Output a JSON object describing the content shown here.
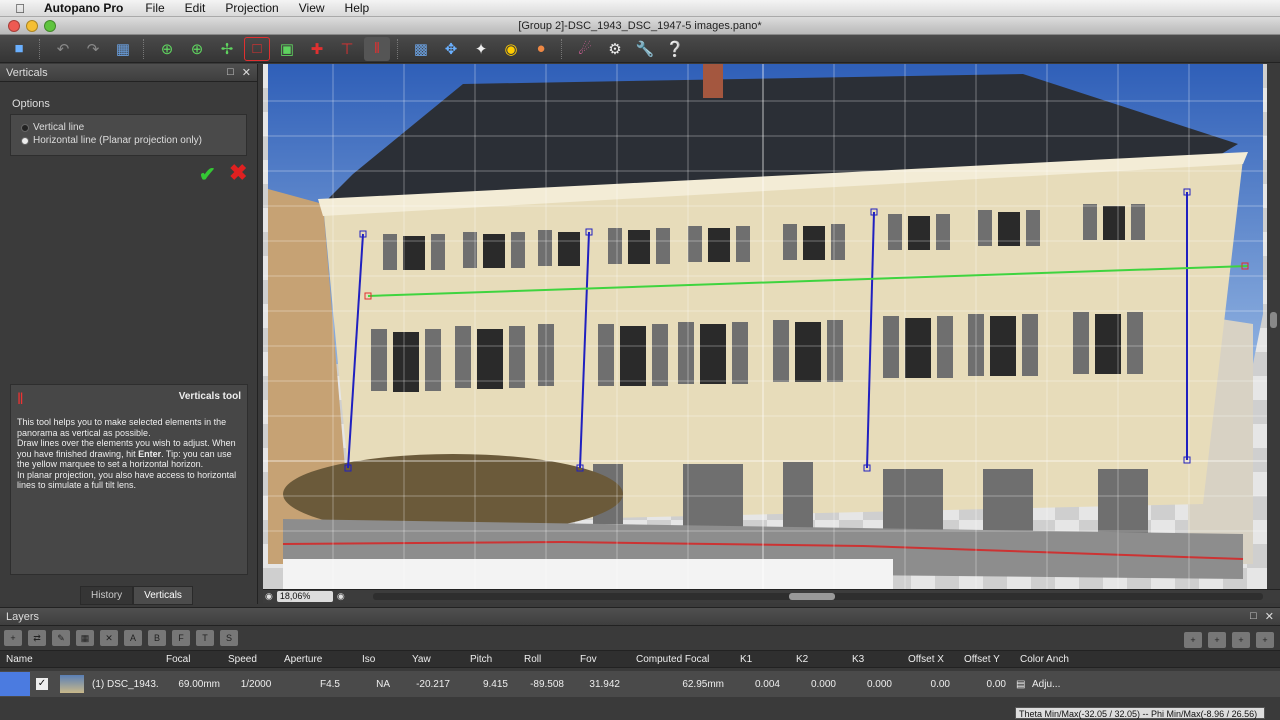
{
  "menubar": {
    "app_name": "Autopano Pro",
    "items": [
      "File",
      "Edit",
      "Projection",
      "View",
      "Help"
    ]
  },
  "window": {
    "title": "[Group 2]-DSC_1943_DSC_1947-5 images.pano*"
  },
  "verticals_panel": {
    "title": "Verticals",
    "options_label": "Options",
    "radio_vertical": "Vertical line",
    "radio_horizontal": "Horizontal line (Planar projection only)",
    "help_title": "Verticals tool",
    "help_p1": "This tool helps you to make selected elements in the panorama as vertical as possible.",
    "help_p2a": "Draw lines over the elements you wish to adjust. When you have finished drawing, hit ",
    "help_p2b": "Enter",
    "help_p2c": ". Tip: you can use the yellow marquee to set a horizontal horizon.",
    "help_p3": "In planar projection, you also have access to horizontal lines to simulate a full tilt lens.",
    "tab_history": "History",
    "tab_verticals": "Verticals"
  },
  "viewport": {
    "zoom": "18,06%"
  },
  "layers": {
    "title": "Layers",
    "columns": [
      "Name",
      "Focal",
      "Speed",
      "Aperture",
      "Iso",
      "Yaw",
      "Pitch",
      "Roll",
      "Fov",
      "Computed Focal",
      "K1",
      "K2",
      "K3",
      "Offset X",
      "Offset Y",
      "Color Anch"
    ],
    "row": {
      "name": "(1) DSC_1943...",
      "focal": "69.00mm",
      "speed": "1/2000",
      "aperture": "F4.5",
      "iso": "NA",
      "yaw": "-20.217",
      "pitch": "9.415",
      "roll": "-89.508",
      "fov": "31.942",
      "computed_focal": "62.95mm",
      "k1": "0.004",
      "k2": "0.000",
      "k3": "0.000",
      "offset_x": "0.00",
      "offset_y": "0.00",
      "color_anchor": "Adju..."
    }
  },
  "status": {
    "text": "Theta Min/Max(-32.05 / 32.05)  --  Phi Min/Max(-8.96 / 26.56)"
  },
  "colors": {
    "accent_green": "#34c734",
    "cancel_red": "#e02020",
    "layer_swatch": "#4b7be0"
  }
}
